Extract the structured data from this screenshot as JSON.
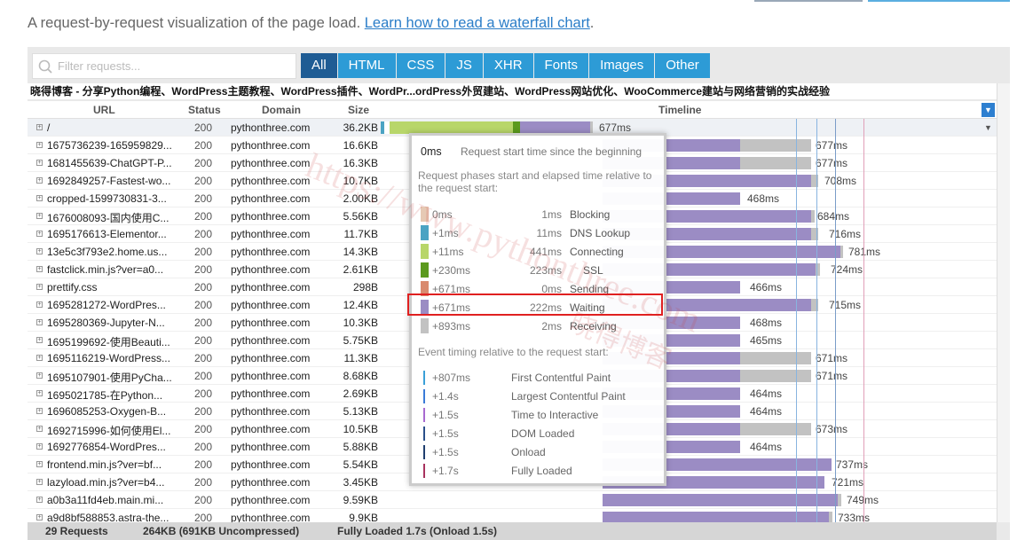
{
  "intro": {
    "text": "A request-by-request visualization of the page load. ",
    "link": "Learn how to read a waterfall chart",
    "period": "."
  },
  "filter": {
    "placeholder": "Filter requests..."
  },
  "tabs": [
    {
      "label": "All",
      "active": true
    },
    {
      "label": "HTML",
      "active": false
    },
    {
      "label": "CSS",
      "active": false
    },
    {
      "label": "JS",
      "active": false
    },
    {
      "label": "XHR",
      "active": false
    },
    {
      "label": "Fonts",
      "active": false
    },
    {
      "label": "Images",
      "active": false
    },
    {
      "label": "Other",
      "active": false
    }
  ],
  "page_title": "晓得博客 - 分享Python编程、WordPress主题教程、WordPress插件、WordPr...ordPress外贸建站、WordPress网站优化、WooCommerce建站与网络营销的实战经验",
  "columns": {
    "url": "URL",
    "status": "Status",
    "domain": "Domain",
    "size": "Size",
    "timeline": "Timeline"
  },
  "rows": [
    {
      "url": "/",
      "status": "200",
      "domain": "pythonthree.com",
      "size": "36.2KB",
      "time": "677ms"
    },
    {
      "url": "1675736239-165959829...",
      "status": "200",
      "domain": "pythonthree.com",
      "size": "16.6KB",
      "time": "677ms"
    },
    {
      "url": "1681455639-ChatGPT-P...",
      "status": "200",
      "domain": "pythonthree.com",
      "size": "16.3KB",
      "time": "677ms"
    },
    {
      "url": "1692849257-Fastest-wo...",
      "status": "200",
      "domain": "pythonthree.com",
      "size": "10.7KB",
      "time": "708ms"
    },
    {
      "url": "cropped-1599730831-3...",
      "status": "200",
      "domain": "pythonthree.com",
      "size": "2.00KB",
      "time": "468ms"
    },
    {
      "url": "1676008093-国内使用C...",
      "status": "200",
      "domain": "pythonthree.com",
      "size": "5.56KB",
      "time": "684ms"
    },
    {
      "url": "1695176613-Elementor...",
      "status": "200",
      "domain": "pythonthree.com",
      "size": "11.7KB",
      "time": "716ms"
    },
    {
      "url": "13e5c3f793e2.home.us...",
      "status": "200",
      "domain": "pythonthree.com",
      "size": "14.3KB",
      "time": "781ms"
    },
    {
      "url": "fastclick.min.js?ver=a0...",
      "status": "200",
      "domain": "pythonthree.com",
      "size": "2.61KB",
      "time": "724ms"
    },
    {
      "url": "prettify.css",
      "status": "200",
      "domain": "pythonthree.com",
      "size": "298B",
      "time": "466ms"
    },
    {
      "url": "1695281272-WordPres...",
      "status": "200",
      "domain": "pythonthree.com",
      "size": "12.4KB",
      "time": "715ms"
    },
    {
      "url": "1695280369-Jupyter-N...",
      "status": "200",
      "domain": "pythonthree.com",
      "size": "10.3KB",
      "time": "468ms"
    },
    {
      "url": "1695199692-使用Beauti...",
      "status": "200",
      "domain": "pythonthree.com",
      "size": "5.75KB",
      "time": "465ms"
    },
    {
      "url": "1695116219-WordPress...",
      "status": "200",
      "domain": "pythonthree.com",
      "size": "11.3KB",
      "time": "671ms"
    },
    {
      "url": "1695107901-使用PyCha...",
      "status": "200",
      "domain": "pythonthree.com",
      "size": "8.68KB",
      "time": "671ms"
    },
    {
      "url": "1695021785-在Python...",
      "status": "200",
      "domain": "pythonthree.com",
      "size": "2.69KB",
      "time": "464ms"
    },
    {
      "url": "1696085253-Oxygen-B...",
      "status": "200",
      "domain": "pythonthree.com",
      "size": "5.13KB",
      "time": "464ms"
    },
    {
      "url": "1692715996-如何使用El...",
      "status": "200",
      "domain": "pythonthree.com",
      "size": "10.5KB",
      "time": "673ms"
    },
    {
      "url": "1692776854-WordPres...",
      "status": "200",
      "domain": "pythonthree.com",
      "size": "5.88KB",
      "time": "464ms"
    },
    {
      "url": "frontend.min.js?ver=bf...",
      "status": "200",
      "domain": "pythonthree.com",
      "size": "5.54KB",
      "time": "737ms"
    },
    {
      "url": "lazyload.min.js?ver=b4...",
      "status": "200",
      "domain": "pythonthree.com",
      "size": "3.45KB",
      "time": "721ms"
    },
    {
      "url": "a0b3a11fd4eb.main.mi...",
      "status": "200",
      "domain": "pythonthree.com",
      "size": "9.59KB",
      "time": "749ms"
    },
    {
      "url": "a9d8bf588853.astra-the...",
      "status": "200",
      "domain": "pythonthree.com",
      "size": "9.9KB",
      "time": "733ms"
    }
  ],
  "footer": {
    "requests": "29 Requests",
    "size": "264KB (691KB Uncompressed)",
    "loaded": "Fully Loaded 1.7s  (Onload 1.5s)"
  },
  "tooltip": {
    "head_value": "0ms",
    "head_desc": "Request start time since the beginning",
    "phases_title": "Request phases start and elapsed time relative to the request start:",
    "phases": [
      {
        "start": "0ms",
        "duration": "1ms",
        "name": "Blocking",
        "color": "#e6c9b4"
      },
      {
        "start": "+1ms",
        "duration": "11ms",
        "name": "DNS Lookup",
        "color": "#4ba3c3"
      },
      {
        "start": "+11ms",
        "duration": "441ms",
        "name": "Connecting",
        "color": "#b8d66a"
      },
      {
        "start": "+230ms",
        "duration": "223ms",
        "name": "SSL",
        "color": "#5c9a1e"
      },
      {
        "start": "+671ms",
        "duration": "0ms",
        "name": "Sending",
        "color": "#d98a6e"
      },
      {
        "start": "+671ms",
        "duration": "222ms",
        "name": "Waiting",
        "color": "#9b8cc4"
      },
      {
        "start": "+893ms",
        "duration": "2ms",
        "name": "Receiving",
        "color": "#c2c2c2"
      }
    ],
    "events_title": "Event timing relative to the request start:",
    "events": [
      {
        "time": "+807ms",
        "name": "First Contentful Paint",
        "color": "#3aa0d8"
      },
      {
        "time": "+1.4s",
        "name": "Largest Contentful Paint",
        "color": "#3a7bd8"
      },
      {
        "time": "+1.5s",
        "name": "Time to Interactive",
        "color": "#a86ad0"
      },
      {
        "time": "+1.5s",
        "name": "DOM Loaded",
        "color": "#2a4f8a"
      },
      {
        "time": "+1.5s",
        "name": "Onload",
        "color": "#1f3e6e"
      },
      {
        "time": "+1.7s",
        "name": "Fully Loaded",
        "color": "#a8325e"
      }
    ]
  },
  "colors": {
    "tab": "#2d9bd6",
    "tab_active": "#1f5c94",
    "waiting": "#9b8cc4",
    "receiving": "#c2c2c2",
    "connecting": "#b8d66a",
    "ssl": "#5c9a1e",
    "dns": "#4ba3c3",
    "highlight": "#e02020"
  },
  "watermark": [
    "https://www.pythonthree.com",
    "晓得博客"
  ]
}
